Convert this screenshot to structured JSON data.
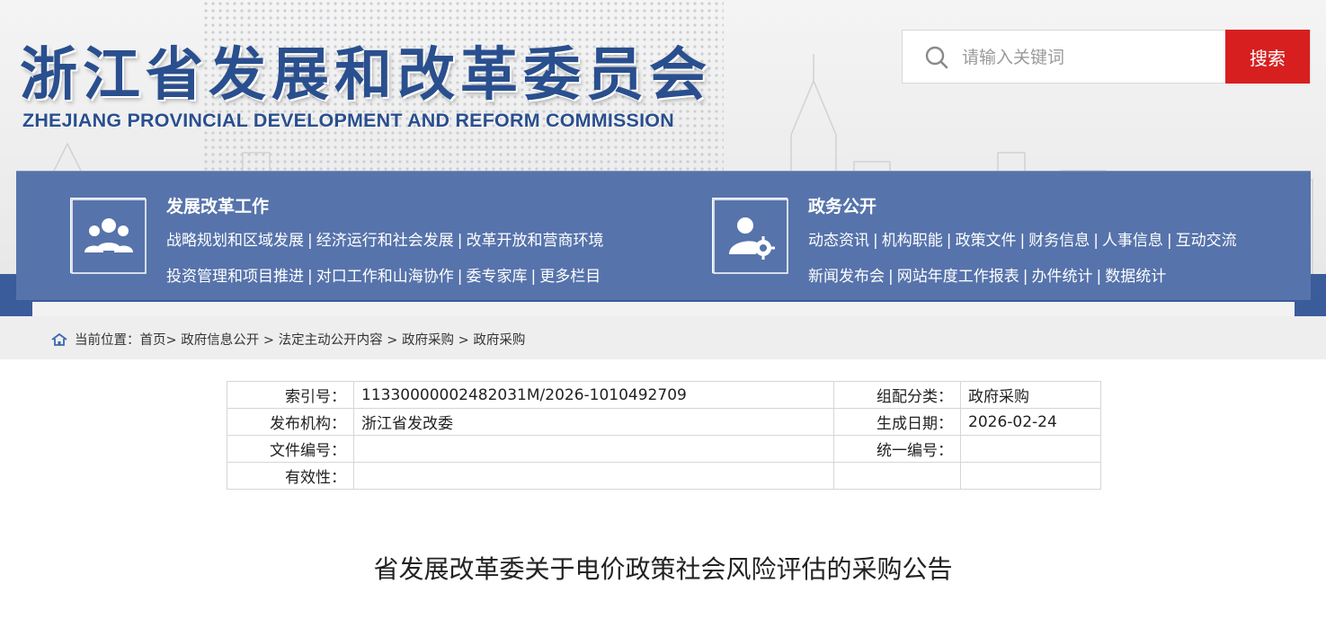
{
  "site": {
    "title": "浙江省发展和改革委员会",
    "subtitle": "ZHEJIANG PROVINCIAL DEVELOPMENT AND REFORM COMMISSION"
  },
  "search": {
    "placeholder": "请输入关键词",
    "button_label": "搜索"
  },
  "nav": {
    "left": {
      "icon": "people-group-icon",
      "heading": "发展改革工作",
      "row1": [
        "战略规划和区域发展",
        "经济运行和社会发展",
        "改革开放和营商环境"
      ],
      "row2": [
        "投资管理和项目推进",
        "对口工作和山海协作",
        "委专家库",
        "更多栏目"
      ]
    },
    "right": {
      "icon": "user-gear-icon",
      "heading": "政务公开",
      "row1": [
        "动态资讯",
        "机构职能",
        "政策文件",
        "财务信息",
        "人事信息",
        "互动交流"
      ],
      "row2": [
        "新闻发布会",
        "网站年度工作报表",
        "办件统计",
        "数据统计"
      ]
    }
  },
  "breadcrumb": {
    "prefix": "当前位置：",
    "items": [
      "首页",
      "政府信息公开",
      "法定主动公开内容",
      "政府采购",
      "政府采购"
    ]
  },
  "meta": {
    "index_label": "索引号：",
    "index_value": "11330000002482031M/2026-1010492709",
    "category_label": "组配分类：",
    "category_value": "政府采购",
    "publisher_label": "发布机构：",
    "publisher_value": "浙江省发改委",
    "date_label": "生成日期：",
    "date_value": "2026-02-24",
    "docno_label": "文件编号：",
    "docno_value": "",
    "uniform_label": "统一编号：",
    "uniform_value": "",
    "validity_label": "有效性：",
    "validity_value": ""
  },
  "article": {
    "title": "省发展改革委关于电价政策社会风险评估的采购公告"
  },
  "colors": {
    "brand_blue": "#2a4f8e",
    "nav_blue": "#5673ab",
    "search_red": "#d71f1f"
  }
}
